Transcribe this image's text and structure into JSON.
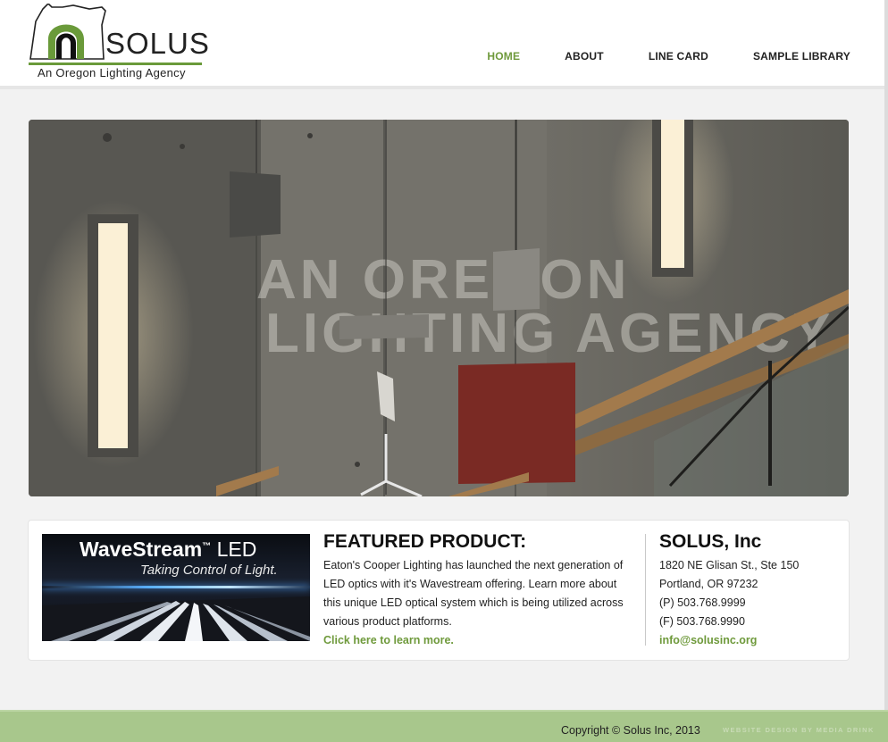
{
  "brand": {
    "name": "SOLUS",
    "tagline": "An Oregon Lighting Agency",
    "accent_color": "#6f9a3c"
  },
  "nav": {
    "items": [
      {
        "label": "HOME",
        "active": true
      },
      {
        "label": "ABOUT",
        "active": false
      },
      {
        "label": "LINE CARD",
        "active": false
      },
      {
        "label": "SAMPLE LIBRARY",
        "active": false
      }
    ]
  },
  "hero": {
    "wall_text_line1": "AN OREGON",
    "wall_text_line2": "LIGHTING AGENCY"
  },
  "promo": {
    "title": "WaveStream",
    "trademark": "™",
    "title_suffix": "LED",
    "subtitle": "Taking Control of Light."
  },
  "featured": {
    "heading": "FEATURED PRODUCT:",
    "body": "Eaton's Cooper Lighting has launched the next generation of LED optics with it's Wavestream offering. Learn more about this unique LED optical system which is being utilized across various product platforms.",
    "link": "Click here to learn more."
  },
  "contact": {
    "heading": "SOLUS, Inc",
    "address1": "1820 NE Glisan St., Ste 150",
    "address2": "Portland, OR 97232",
    "phone": "(P) 503.768.9999",
    "fax": "(F) 503.768.9990",
    "email": "info@solusinc.org"
  },
  "footer": {
    "copyright": "Copyright © Solus Inc, 2013",
    "credit": "WEBSITE DESIGN BY MEDIA DRINK"
  }
}
